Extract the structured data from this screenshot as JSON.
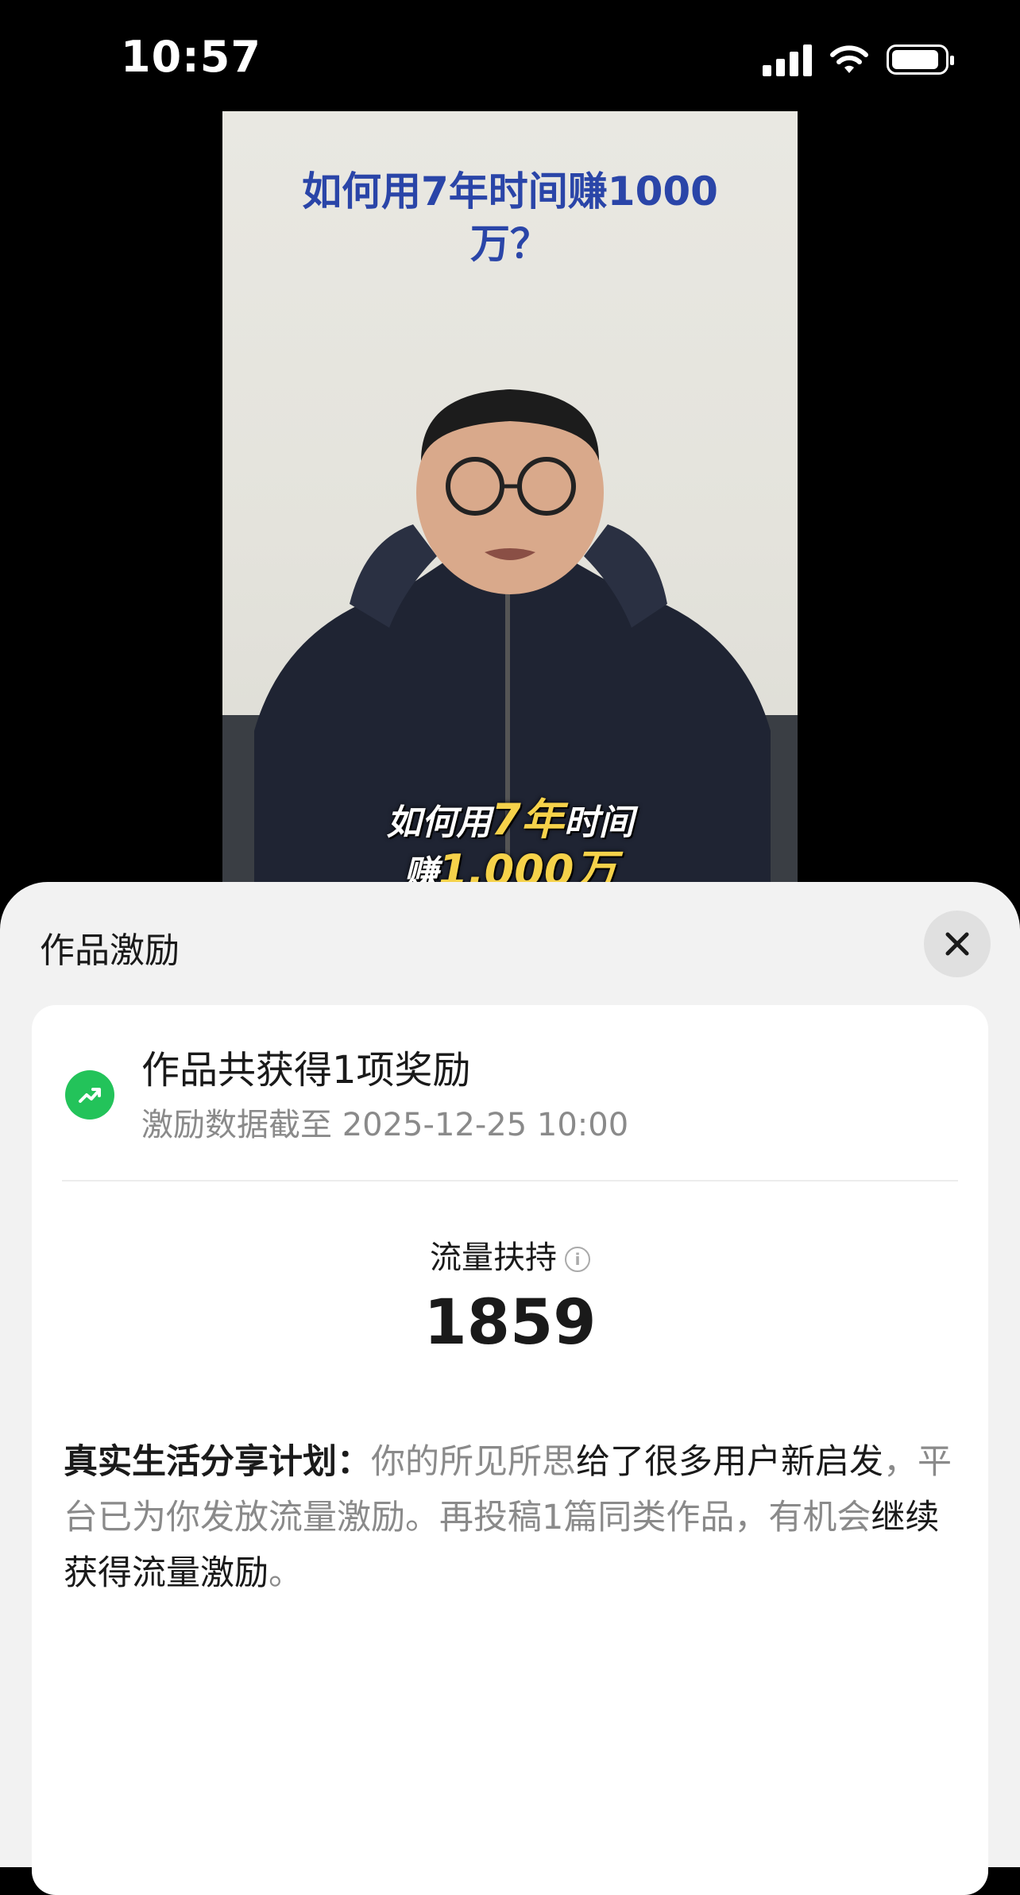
{
  "status_bar": {
    "time": "10:57"
  },
  "video": {
    "title": "如何用7年时间赚1000万？",
    "caption_line1_prefix": "如何用",
    "caption_line1_highlight": "7年",
    "caption_line1_suffix": "时间",
    "caption_line2_prefix": "赚",
    "caption_line2_highlight": "1,000万"
  },
  "sheet": {
    "title": "作品激励",
    "close_icon": "close-icon"
  },
  "reward": {
    "icon": "trend-up-icon",
    "title": "作品共获得1项奖励",
    "date": "激励数据截至 2025-12-25 10:00"
  },
  "metric": {
    "label": "流量扶持",
    "value": "1859"
  },
  "description": {
    "plan": "真实生活分享计划：",
    "part1": "你的所见所思",
    "part2": "给了很多用户新启发",
    "part3": "，平台已为你发放流量激励。再投稿1篇同类作品，有机会",
    "part4": "继续获得流量激励",
    "part5": "。"
  },
  "colors": {
    "accent_green": "#23c35a",
    "title_blue": "#2a45a8",
    "caption_yellow": "#f6d24a"
  }
}
